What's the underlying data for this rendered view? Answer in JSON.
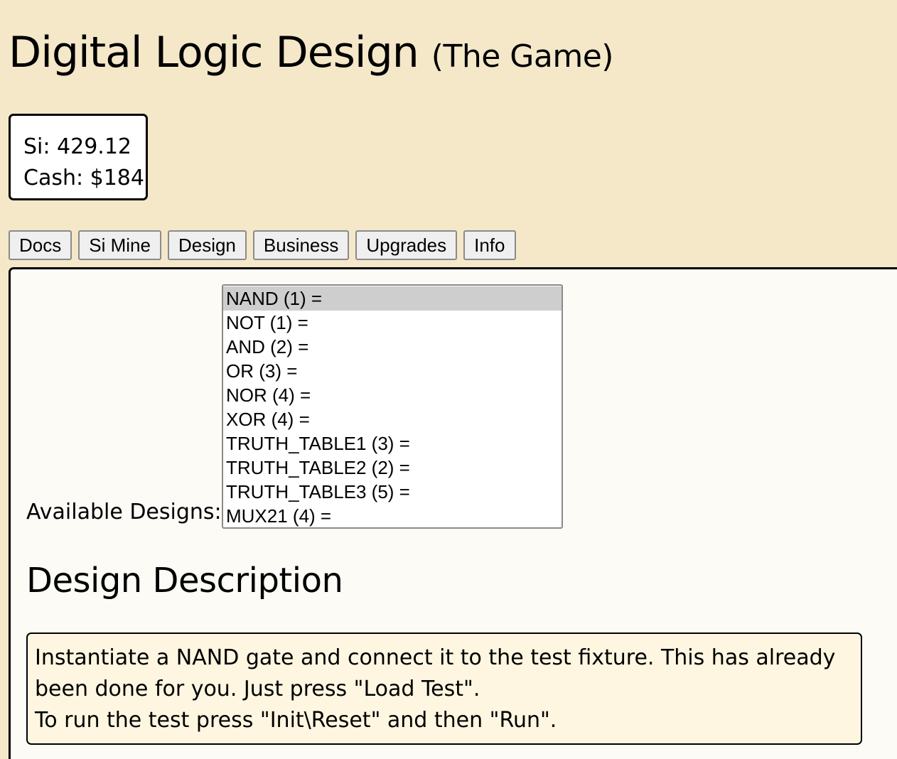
{
  "header": {
    "title": "Digital Logic Design",
    "subtitle": "(The Game)"
  },
  "stats": {
    "si": "Si: 429.12",
    "cash": "Cash: $184"
  },
  "tabs": [
    {
      "label": "Docs"
    },
    {
      "label": "Si Mine"
    },
    {
      "label": "Design"
    },
    {
      "label": "Business"
    },
    {
      "label": "Upgrades"
    },
    {
      "label": "Info"
    }
  ],
  "designs": {
    "label": "Available Designs:",
    "selected": "NAND (1) =",
    "options": [
      "NAND (1) =",
      "NOT (1) =",
      "AND (2) =",
      "OR (3) =",
      "NOR (4) =",
      "XOR (4) =",
      "TRUTH_TABLE1 (3) =",
      "TRUTH_TABLE2 (2) =",
      "TRUTH_TABLE3 (5) =",
      "MUX21 (4) ="
    ]
  },
  "description": {
    "heading": "Design Description",
    "lines": [
      "Instantiate a NAND gate and connect it to the test fixture. This has already",
      "been done for you. Just press \"Load Test\".",
      "To run the test press \"Init\\Reset\" and then \"Run\"."
    ]
  }
}
